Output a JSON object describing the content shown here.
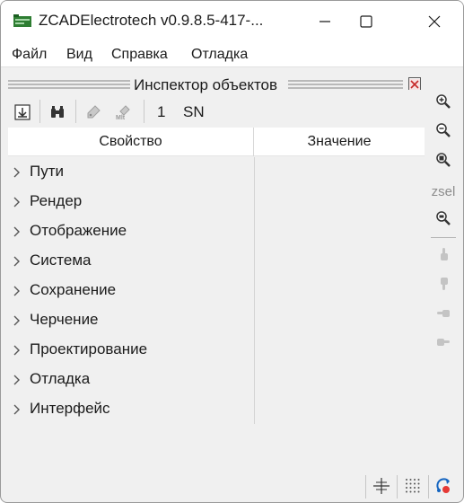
{
  "window": {
    "title": "ZCADElectrotech v0.9.8.5-417-..."
  },
  "menu": {
    "items": [
      "Файл",
      "Вид",
      "Справка",
      "Отладка"
    ]
  },
  "panel": {
    "title": "Инспектор объектов"
  },
  "toolbar": {
    "count_value": "1",
    "mode_label": "SN",
    "icons": [
      "anchor-icon",
      "binoculars-icon",
      "tag-icon",
      "measure-tag-icon"
    ]
  },
  "grid": {
    "columns": [
      "Свойство",
      "Значение"
    ],
    "rows": [
      "Пути",
      "Рендер",
      "Отображение",
      "Система",
      "Сохранение",
      "Черчение",
      "Проектирование",
      "Отладка",
      "Интерфейс"
    ]
  },
  "side_toolbar": {
    "zsel_label": "zsel",
    "icons": [
      "zoom-in-icon",
      "zoom-out-icon",
      "zoom-window-icon",
      "zoom-selection-icon",
      "pointing-hand-up-icon",
      "pointing-hand-down-icon",
      "pointing-hand-left-icon",
      "pointing-hand-right-icon"
    ]
  },
  "status": {
    "icons": [
      "snap-crosshair-icon",
      "grid-dots-icon",
      "ortho-rotate-icon"
    ]
  },
  "colors": {
    "window_bg": "#f0f0f0",
    "titlebar_bg": "#ffffff",
    "app_icon": "#2e7d32",
    "close_badge": "#c62828"
  }
}
